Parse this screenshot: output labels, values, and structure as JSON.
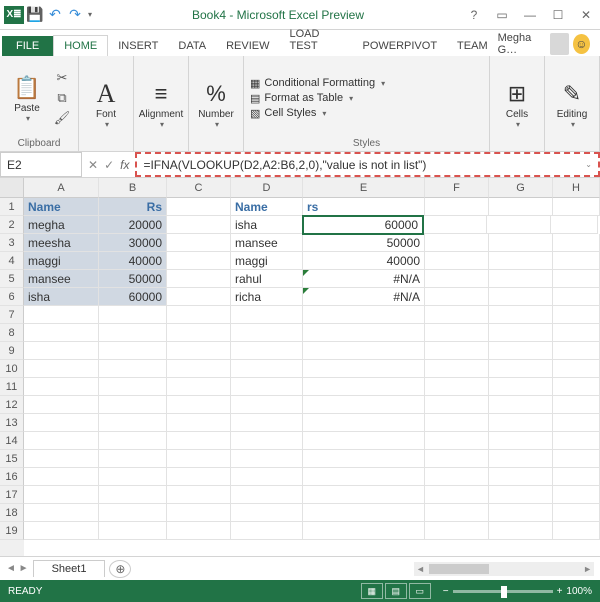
{
  "window": {
    "title": "Book4 - Microsoft Excel Preview",
    "user": "Megha G…"
  },
  "tabs": {
    "file": "FILE",
    "home": "HOME",
    "insert": "INSERT",
    "data": "DATA",
    "review": "REVIEW",
    "loadtest": "LOAD TEST",
    "powerpivot": "POWERPIVOT",
    "team": "TEAM"
  },
  "ribbon": {
    "paste": "Paste",
    "clipboard": "Clipboard",
    "font": "Font",
    "alignment": "Alignment",
    "number": "Number",
    "condfmt": "Conditional Formatting",
    "fmttable": "Format as Table",
    "cellstyles": "Cell Styles",
    "styles": "Styles",
    "cells": "Cells",
    "editing": "Editing"
  },
  "namebox": "E2",
  "formula": "=IFNA(VLOOKUP(D2,A2:B6,2,0),\"value is not in list\")",
  "colheads": [
    "A",
    "B",
    "C",
    "D",
    "E",
    "F",
    "G",
    "H"
  ],
  "rowcount": 19,
  "table1": {
    "h1": "Name",
    "h2": "Rs",
    "rows": [
      {
        "n": "megha",
        "v": "20000"
      },
      {
        "n": "meesha",
        "v": "30000"
      },
      {
        "n": "maggi",
        "v": "40000"
      },
      {
        "n": "mansee",
        "v": "50000"
      },
      {
        "n": "isha",
        "v": "60000"
      }
    ]
  },
  "table2": {
    "h1": "Name",
    "h2": "rs",
    "rows": [
      {
        "n": "isha",
        "v": "60000"
      },
      {
        "n": "mansee",
        "v": "50000"
      },
      {
        "n": "maggi",
        "v": "40000"
      },
      {
        "n": "rahul",
        "v": "#N/A"
      },
      {
        "n": "richa",
        "v": "#N/A"
      }
    ]
  },
  "sheet": {
    "name": "Sheet1"
  },
  "status": {
    "ready": "READY",
    "zoom": "100%"
  }
}
